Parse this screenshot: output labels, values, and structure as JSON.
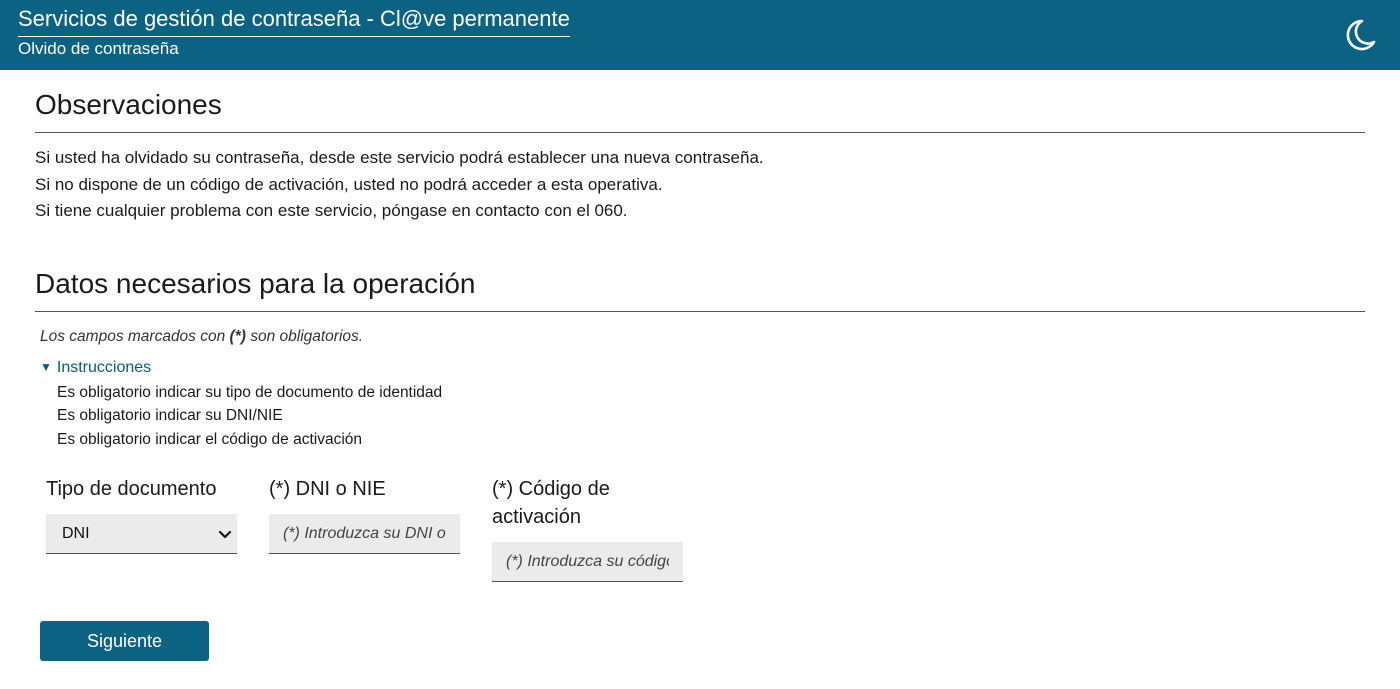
{
  "header": {
    "title": "Servicios de gestión de contraseña - Cl@ve permanente",
    "subtitle": "Olvido de contraseña",
    "theme_icon": "moon-icon"
  },
  "observaciones": {
    "title": "Observaciones",
    "lines": [
      "Si usted ha olvidado su contraseña, desde este servicio podrá establecer una nueva contraseña.",
      "Si no dispone de un código de activación, usted no podrá acceder a esta operativa.",
      "Si tiene cualquier problema con este servicio, póngase en contacto con el 060."
    ]
  },
  "datos": {
    "title": "Datos necesarios para la operación",
    "note_prefix": "Los campos marcados con ",
    "note_mark": "(*)",
    "note_suffix": " son obligatorios.",
    "instructions": {
      "label": "Instrucciones",
      "toggle_glyph": "▼",
      "items": [
        "Es obligatorio indicar su tipo de documento de identidad",
        "Es obligatorio indicar su DNI/NIE",
        "Es obligatorio indicar el código de activación"
      ]
    }
  },
  "form": {
    "doc_type": {
      "label": "Tipo de documento",
      "selected": "DNI"
    },
    "dni": {
      "label": "(*) DNI o NIE",
      "placeholder": "(*) Introduzca su DNI o NIE",
      "value": ""
    },
    "code": {
      "label": "(*) Código de activación",
      "placeholder": "(*) Introduzca su código de activación",
      "value": ""
    },
    "submit_label": "Siguiente"
  },
  "colors": {
    "brand": "#0b6283",
    "link": "#0b5a7a",
    "input_bg": "#ebebeb"
  }
}
